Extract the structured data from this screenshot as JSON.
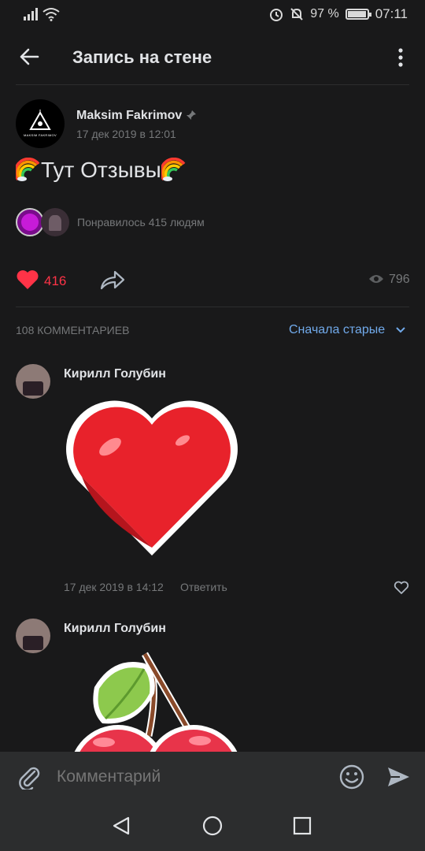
{
  "status": {
    "battery": "97 %",
    "time": "07:11"
  },
  "header": {
    "title": "Запись на стене"
  },
  "post": {
    "author": "Maksim Fakrimov",
    "date": "17 дек 2019 в 12:01",
    "avatar_text": "MAKSIM FAKRIMOV",
    "text": "Тут Отзывы",
    "liked_by": "Понравилось 415 людям",
    "like_count": "416",
    "views": "796"
  },
  "comments_header": {
    "count_label": "108 КОММЕНТАРИЕВ",
    "sort_label": "Сначала старые"
  },
  "comments": [
    {
      "name": "Кирилл Голубин",
      "date": "17 дек 2019 в 14:12",
      "reply": "Ответить",
      "sticker": "heart"
    },
    {
      "name": "Кирилл Голубин",
      "sticker": "cherry"
    }
  ],
  "input": {
    "placeholder": "Комментарий"
  },
  "colors": {
    "accent": "#71aaeb",
    "like": "#ff3347",
    "bg": "#19191a",
    "panel": "#2c2d2e"
  }
}
